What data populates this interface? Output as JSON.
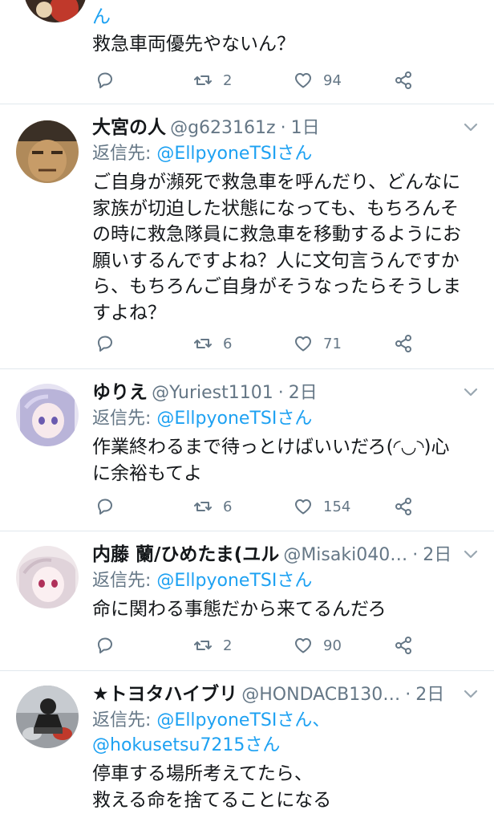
{
  "tweets": [
    {
      "name": "",
      "handle": "",
      "time": "",
      "reply_prefix": "",
      "mentions": "",
      "body_lines": [
        "ん",
        "救急車両優先やないん？"
      ],
      "replies": "",
      "retweets": "2",
      "likes": "94"
    },
    {
      "name": "大宮の人",
      "handle": "@g623161z",
      "time": "1日",
      "reply_prefix": "返信先:",
      "mentions": "@EllpyoneTSIさん",
      "body_lines": [
        "ご自身が瀕死で救急車を呼んだり、どんなに",
        "家族が切迫した状態になっても、もちろんそ",
        "の時に救急隊員に救急車を移動するようにお",
        "願いするんですよね？人に文句言うんですか",
        "ら、もちろんご自身がそうなったらそうしま",
        "すよね？"
      ],
      "replies": "",
      "retweets": "6",
      "likes": "71"
    },
    {
      "name": "ゆりえ",
      "handle": "@Yuriest1101",
      "time": "2日",
      "reply_prefix": "返信先:",
      "mentions": "@EllpyoneTSIさん",
      "body_lines": [
        "作業終わるまで待っとけばいいだろ(◜◡◝)心",
        "に余裕もてよ"
      ],
      "replies": "",
      "retweets": "6",
      "likes": "154"
    },
    {
      "name": "内藤 蘭/ひめたま(ユル",
      "handle": "@Misaki040…",
      "time": "2日",
      "reply_prefix": "返信先:",
      "mentions": "@EllpyoneTSIさん",
      "body_lines": [
        "命に関わる事態だから来てるんだろ"
      ],
      "replies": "",
      "retweets": "2",
      "likes": "90"
    },
    {
      "name": "★トヨタハイブリ",
      "handle": "@HONDACB130…",
      "time": "2日",
      "reply_prefix": "返信先:",
      "mentions": "@EllpyoneTSIさん、",
      "mentions2": "@hokusetsu7215さん",
      "body_lines": [
        "停車する場所考えてたら、",
        "救える命を捨てることになる"
      ]
    }
  ],
  "icons": {
    "reply": "reply-icon",
    "retweet": "retweet-icon",
    "like": "like-icon",
    "share": "share-icon",
    "caret": "chevron-down-icon"
  },
  "colors": {
    "link": "#1da1f2",
    "muted": "#657786",
    "text": "#14171a",
    "divider": "#e1e8ed"
  }
}
